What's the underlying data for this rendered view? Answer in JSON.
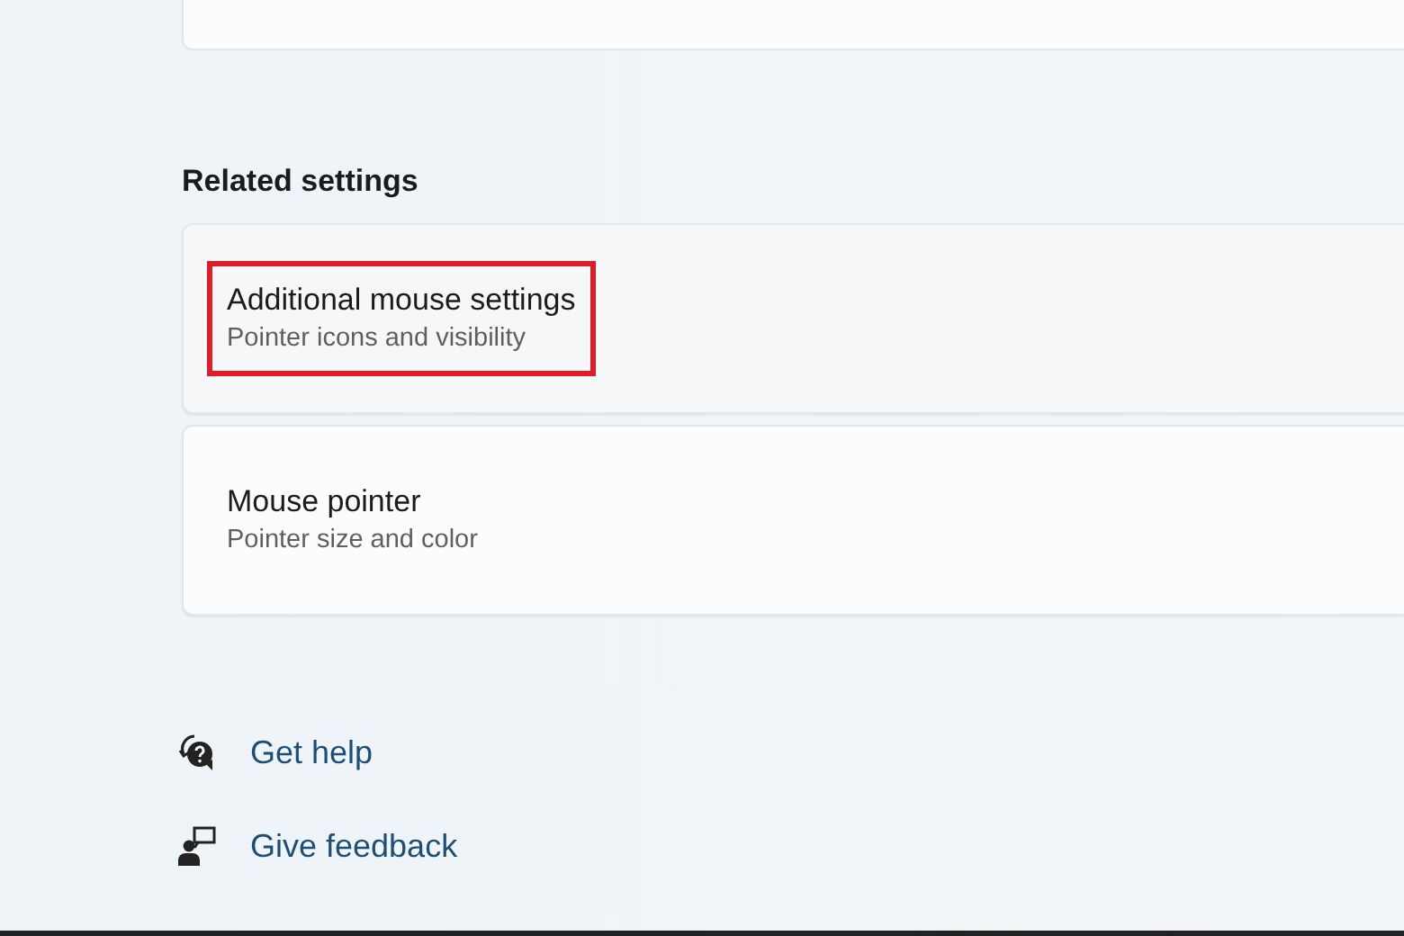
{
  "section_title": "Related settings",
  "items": [
    {
      "title": "Additional mouse settings",
      "subtitle": "Pointer icons and visibility",
      "hovered": true,
      "highlighted": true
    },
    {
      "title": "Mouse pointer",
      "subtitle": "Pointer size and color",
      "hovered": false,
      "highlighted": false
    }
  ],
  "links": [
    {
      "kind": "help",
      "label": "Get help"
    },
    {
      "kind": "feedback",
      "label": "Give feedback"
    }
  ]
}
